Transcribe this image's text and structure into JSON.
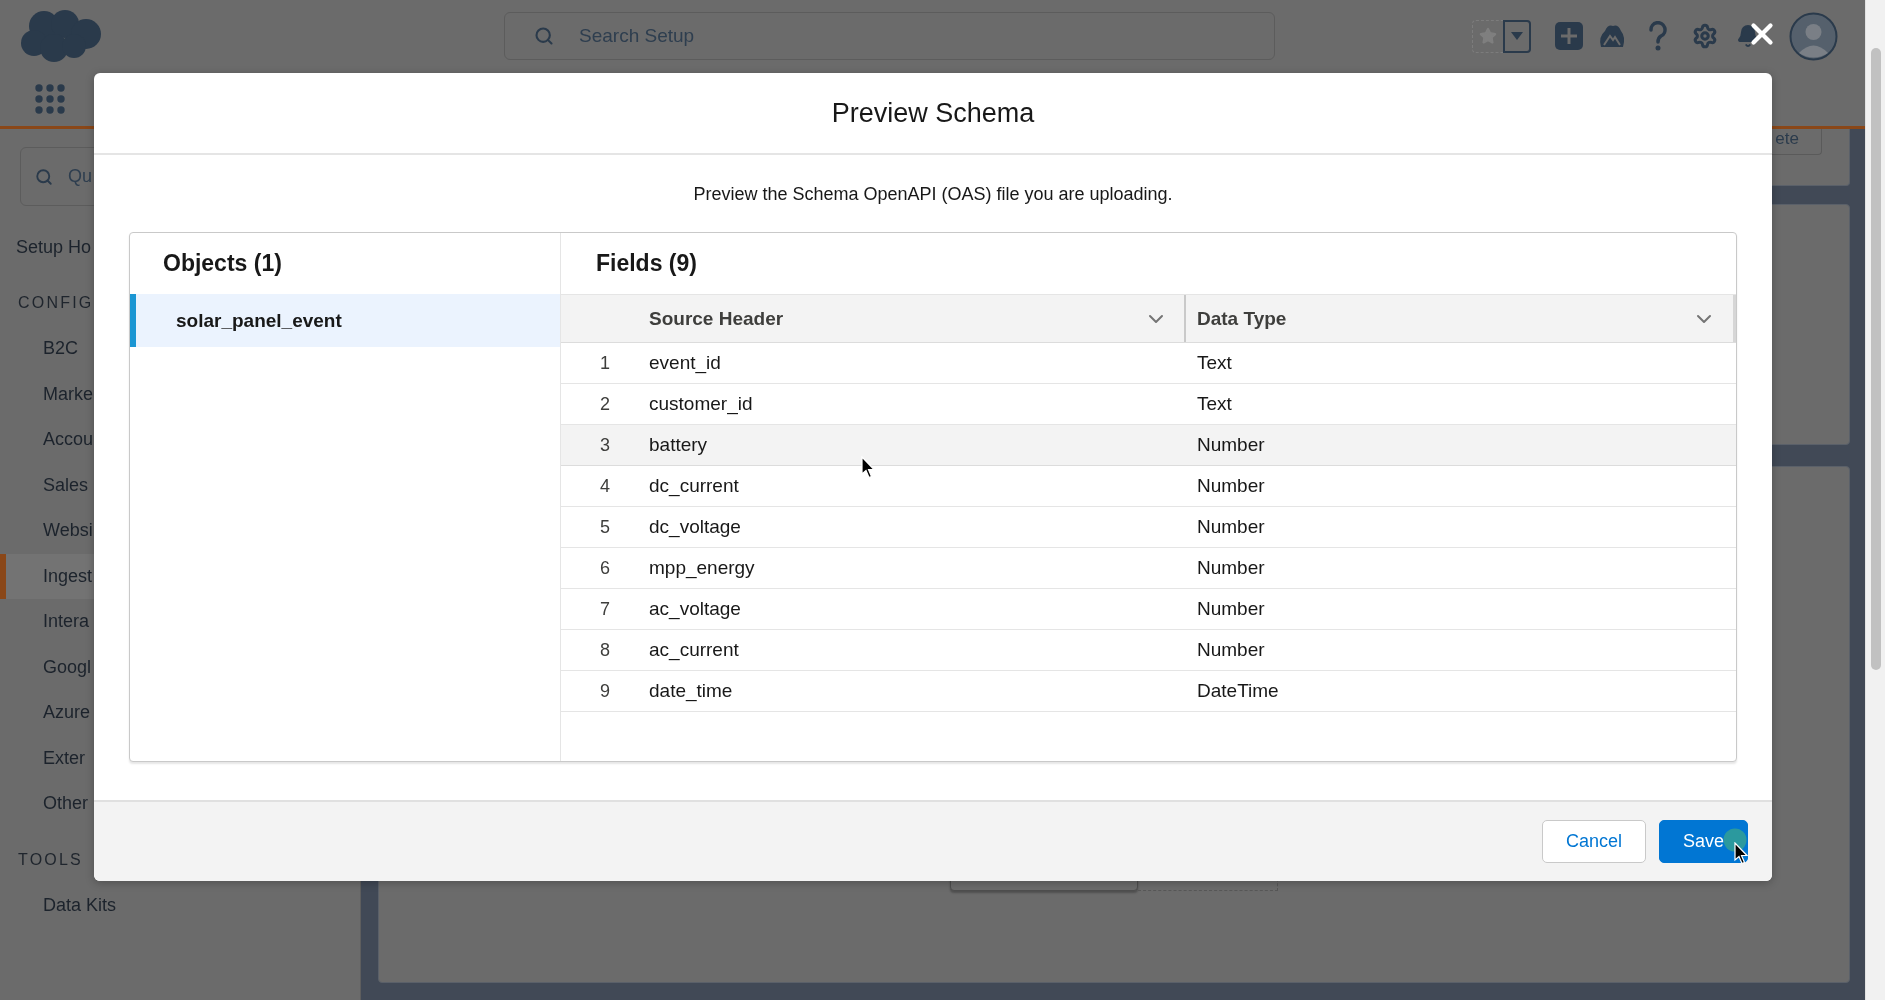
{
  "header": {
    "search": {
      "placeholder": "Search Setup"
    }
  },
  "sidebar": {
    "quick_find": {
      "placeholder": "Qu"
    },
    "home_link": "Setup Ho",
    "sections": [
      {
        "title": "CONFIG",
        "items": [
          {
            "label": "B2C",
            "selected": false
          },
          {
            "label": "Marke",
            "selected": false
          },
          {
            "label": "Accou",
            "selected": false
          },
          {
            "label": "Sales",
            "selected": false
          },
          {
            "label": "Websi",
            "selected": false
          },
          {
            "label": "Ingest",
            "selected": true
          },
          {
            "label": "Intera",
            "selected": false
          },
          {
            "label": "Googl",
            "selected": false
          },
          {
            "label": "Azure",
            "selected": false
          },
          {
            "label": "Exter",
            "selected": false
          },
          {
            "label": "Other",
            "selected": false
          }
        ]
      },
      {
        "title": "TOOLS",
        "items": [
          {
            "label": "Data Kits",
            "selected": false
          }
        ]
      }
    ]
  },
  "page": {
    "action_button": "ete"
  },
  "modal": {
    "title": "Preview Schema",
    "description": "Preview the Schema OpenAPI (OAS) file you are uploading.",
    "objects": {
      "title": "Objects (1)",
      "items": [
        {
          "name": "solar_panel_event",
          "selected": true
        }
      ]
    },
    "fields": {
      "title": "Fields (9)",
      "columns": [
        "Source Header",
        "Data Type"
      ],
      "rows": [
        {
          "number": "1",
          "source_header": "event_id",
          "data_type": "Text",
          "highlighted": false
        },
        {
          "number": "2",
          "source_header": "customer_id",
          "data_type": "Text",
          "highlighted": false
        },
        {
          "number": "3",
          "source_header": "battery",
          "data_type": "Number",
          "highlighted": true
        },
        {
          "number": "4",
          "source_header": "dc_current",
          "data_type": "Number",
          "highlighted": false
        },
        {
          "number": "5",
          "source_header": "dc_voltage",
          "data_type": "Number",
          "highlighted": false
        },
        {
          "number": "6",
          "source_header": "mpp_energy",
          "data_type": "Number",
          "highlighted": false
        },
        {
          "number": "7",
          "source_header": "ac_voltage",
          "data_type": "Number",
          "highlighted": false
        },
        {
          "number": "8",
          "source_header": "ac_current",
          "data_type": "Number",
          "highlighted": false
        },
        {
          "number": "9",
          "source_header": "date_time",
          "data_type": "DateTime",
          "highlighted": false
        }
      ]
    },
    "buttons": [
      {
        "label": "Cancel",
        "kind": "neutral"
      },
      {
        "label": "Save",
        "kind": "brand"
      }
    ]
  }
}
